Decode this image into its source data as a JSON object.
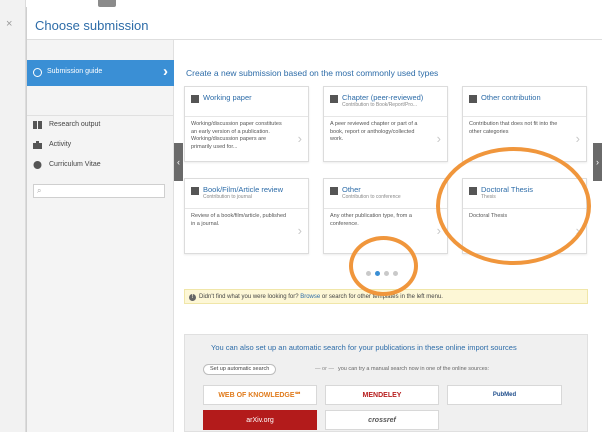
{
  "dialog": {
    "title": "Choose submission",
    "close_glyph": "×"
  },
  "sidebar": {
    "guide_label": "Submission guide",
    "items": [
      {
        "label": "Research output",
        "icon": "book-icon"
      },
      {
        "label": "Activity",
        "icon": "briefcase-icon"
      },
      {
        "label": "Curriculum Vitae",
        "icon": "person-icon"
      }
    ],
    "search_placeholder": ""
  },
  "main": {
    "intro": "Create a new submission based on the most commonly used types",
    "cards": [
      {
        "title": "Working paper",
        "subtitle": "",
        "desc": "Working/discussion paper constitutes an early version of a publication. Working/discussion papers are primarily used for..."
      },
      {
        "title": "Chapter (peer-reviewed)",
        "subtitle": "Contribution to Book/Report/Pro...",
        "desc": "A peer reviewed chapter or part of a book, report or anthology/collected work."
      },
      {
        "title": "Other contribution",
        "subtitle": "",
        "desc": "Contribution that does not fit into the other categories"
      },
      {
        "title": "Book/Film/Article review",
        "subtitle": "Contribution to journal",
        "desc": "Review of a book/film/article, published in a journal."
      },
      {
        "title": "Other",
        "subtitle": "Contribution to conference",
        "desc": "Any other publication type, from a conference."
      },
      {
        "title": "Doctoral Thesis",
        "subtitle": "Thesis",
        "desc": "Doctoral Thesis"
      }
    ],
    "pager": {
      "pages": 4,
      "active": 2
    },
    "notice": {
      "before": "Didn't find what you were looking for? ",
      "link": "Browse",
      "after": " or search for other templates in the left menu."
    }
  },
  "import": {
    "text": "You can also set up an automatic search for your publications in these online import sources",
    "setup_button": "Set up automatic search",
    "or": "— or —",
    "manual": "you can try a manual search now in one of the online sources:",
    "sources": [
      "WEB OF KNOWLEDGE℠",
      "MENDELEY",
      "PubMed",
      "arXiv.org",
      "crossref"
    ]
  },
  "colors": {
    "accent": "#3a8fd5",
    "highlight": "#f0963c",
    "link": "#2d6ca8"
  }
}
